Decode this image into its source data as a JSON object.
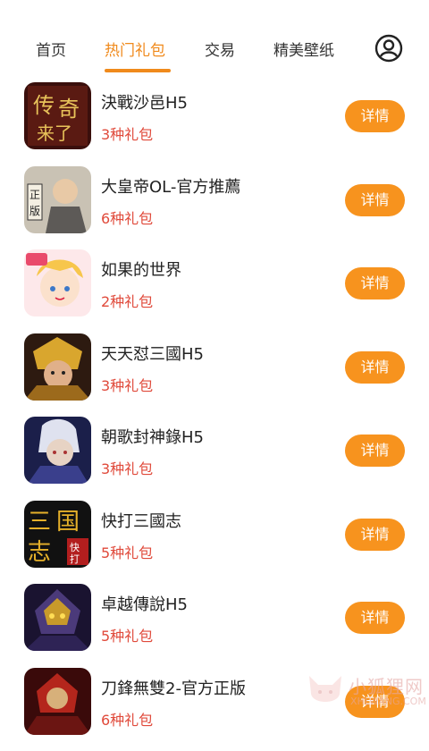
{
  "tabs": [
    {
      "label": "首页",
      "active": false
    },
    {
      "label": "热门礼包",
      "active": true
    },
    {
      "label": "交易",
      "active": false
    },
    {
      "label": "精美壁纸",
      "active": false
    }
  ],
  "profile_icon": "user-circle-icon",
  "accent_color": "#f08a1c",
  "items": [
    {
      "title": "決戰沙邑H5",
      "count": "3种礼包",
      "button": "详情",
      "icon": "game-icon-juezhanshayi"
    },
    {
      "title": "大皇帝OL-官方推薦",
      "count": "6种礼包",
      "button": "详情",
      "icon": "game-icon-dahuangdi"
    },
    {
      "title": "如果的世界",
      "count": "2种礼包",
      "button": "详情",
      "icon": "game-icon-ruguodeshijie"
    },
    {
      "title": "天天怼三國H5",
      "count": "3种礼包",
      "button": "详情",
      "icon": "game-icon-tiantiandui"
    },
    {
      "title": "朝歌封神錄H5",
      "count": "3种礼包",
      "button": "详情",
      "icon": "game-icon-chaoge"
    },
    {
      "title": "快打三國志",
      "count": "5种礼包",
      "button": "详情",
      "icon": "game-icon-kuaida"
    },
    {
      "title": "卓越傳說H5",
      "count": "5种礼包",
      "button": "详情",
      "icon": "game-icon-zhuoyue"
    },
    {
      "title": "刀鋒無雙2-官方正版",
      "count": "6种礼包",
      "button": "详情",
      "icon": "game-icon-daofeng"
    }
  ],
  "watermark": {
    "text": "小狐狸网",
    "sub": "XHLWANG.COM",
    "icon": "fox-logo-icon"
  }
}
